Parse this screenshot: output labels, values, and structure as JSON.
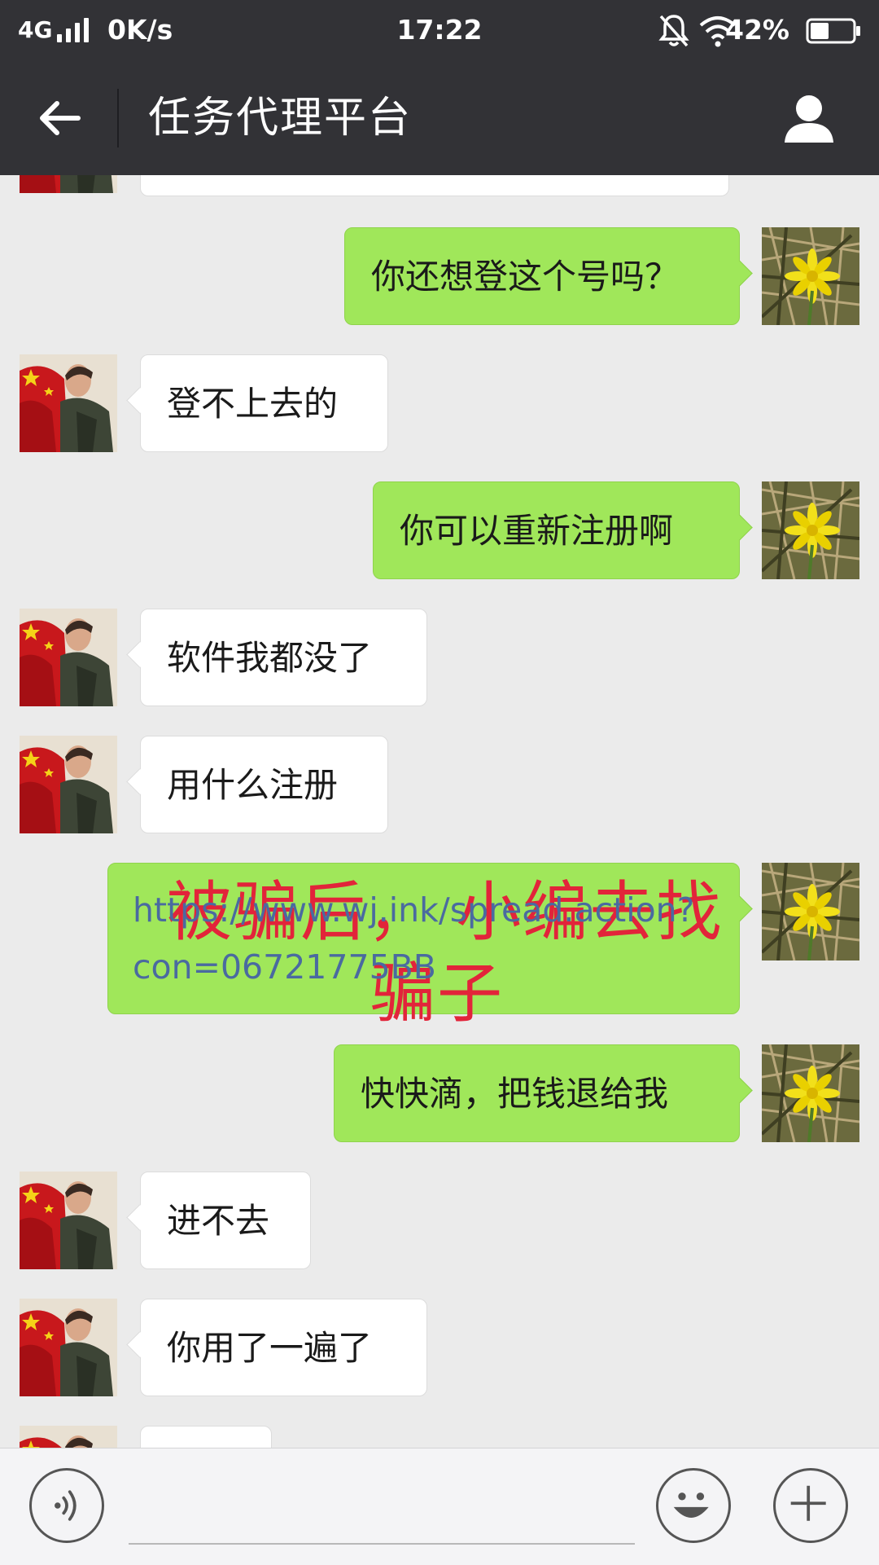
{
  "status_bar": {
    "network": "4G",
    "speed": "0K/s",
    "time": "17:22",
    "battery": "42%",
    "icons": [
      "signal-icon",
      "mute-bell-icon",
      "wifi-icon",
      "battery-icon"
    ]
  },
  "header": {
    "title": "任务代理平台",
    "back_icon": "back-arrow-icon",
    "profile_icon": "person-icon"
  },
  "messages": [
    {
      "side": "left",
      "text": ""
    },
    {
      "side": "right",
      "text": "你还想登这个号吗？"
    },
    {
      "side": "left",
      "text": "登不上去的"
    },
    {
      "side": "right",
      "text": "你可以重新注册啊"
    },
    {
      "side": "left",
      "text": "软件我都没了"
    },
    {
      "side": "left",
      "text": "用什么注册"
    },
    {
      "side": "right",
      "text": "https://www.wj.ink/spread.action?con=06721775BB",
      "line1": "https://www.wj.ink/spread.action?",
      "line2": "con=06721775BB"
    },
    {
      "side": "right",
      "text": "快快滴，把钱退给我"
    },
    {
      "side": "left",
      "text": "进不去"
    },
    {
      "side": "left",
      "text": "你用了一遍了"
    },
    {
      "side": "left",
      "text": ""
    }
  ],
  "overlay": {
    "line1": "被骗后， 小编去找",
    "line2": "骗子",
    "color": "#e2243a"
  },
  "input_bar": {
    "voice_icon": "voice-icon",
    "emoji_icon": "emoji-icon",
    "plus_icon": "plus-icon"
  },
  "colors": {
    "bar": "#323236",
    "chat_bg": "#ebebeb",
    "sent_bubble": "#a0e75a",
    "received_bubble": "#ffffff"
  }
}
